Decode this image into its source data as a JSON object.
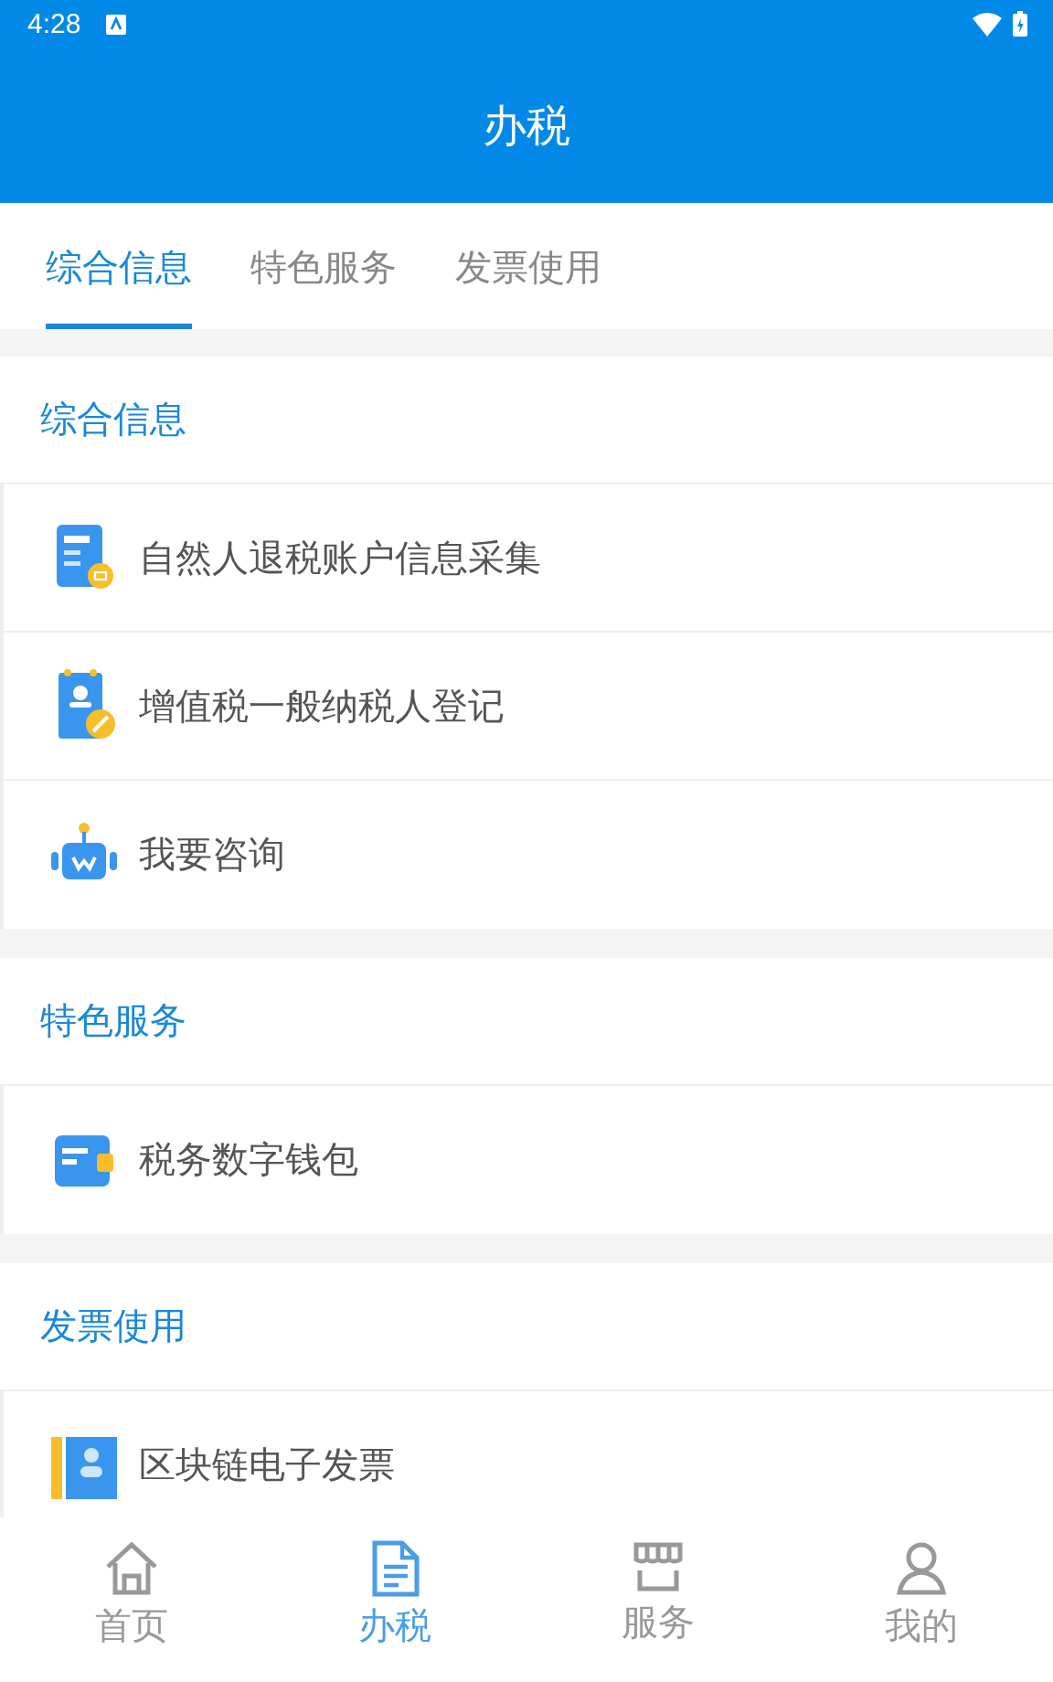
{
  "status_bar": {
    "time": "4:28"
  },
  "app_bar": {
    "title": "办税"
  },
  "tabs": [
    {
      "label": "综合信息",
      "selected": true
    },
    {
      "label": "特色服务",
      "selected": false
    },
    {
      "label": "发票使用",
      "selected": false
    }
  ],
  "sections": [
    {
      "title": "综合信息",
      "items": [
        {
          "label": "自然人退税账户信息采集",
          "kind": "form"
        },
        {
          "label": "增值税一般纳税人登记",
          "kind": "register"
        },
        {
          "label": "我要咨询",
          "kind": "robot"
        }
      ]
    },
    {
      "title": "特色服务",
      "items": [
        {
          "label": "税务数字钱包",
          "kind": "wallet"
        }
      ]
    },
    {
      "title": "发票使用",
      "items": [
        {
          "label": "区块链电子发票",
          "kind": "invoice"
        }
      ]
    }
  ],
  "bottom_nav": [
    {
      "label": "首页",
      "kind": "home",
      "selected": false
    },
    {
      "label": "办税",
      "kind": "document",
      "selected": true
    },
    {
      "label": "服务",
      "kind": "store",
      "selected": false
    },
    {
      "label": "我的",
      "kind": "person",
      "selected": false
    }
  ]
}
